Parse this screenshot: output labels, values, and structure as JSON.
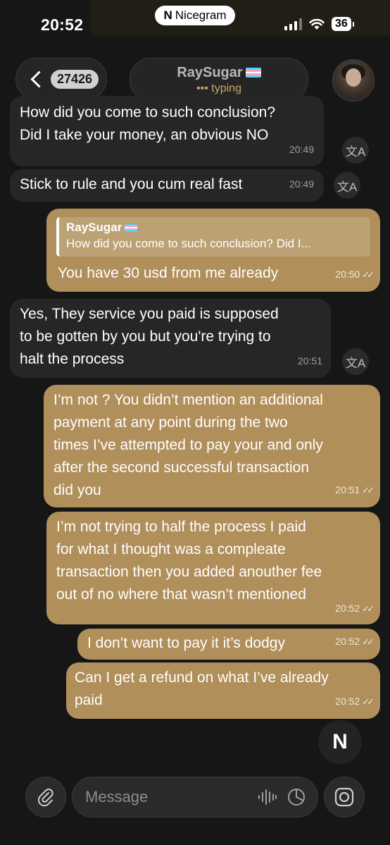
{
  "status": {
    "time": "20:52",
    "app_badge": "Nicegram",
    "battery": "36"
  },
  "header": {
    "back_count": "27426",
    "contact_name": "RaySugar",
    "status_text": "typing"
  },
  "messages": [
    {
      "dir": "in",
      "lines": [
        "How did you come to such conclusion?",
        "Did I take your money, an obvious NO"
      ],
      "time": "20:49",
      "translate": "文A"
    },
    {
      "dir": "in",
      "lines": [
        "Stick to rule and you cum real fast"
      ],
      "time": "20:49",
      "translate": "文A"
    },
    {
      "dir": "out",
      "reply_name": "RaySugar",
      "reply_text": "How did you come to such conclusion? Did I...",
      "lines": [
        "You have 30 usd from me already"
      ],
      "time": "20:50"
    },
    {
      "dir": "in",
      "lines": [
        "Yes, They service you paid is supposed",
        "to be gotten by you but you're trying to",
        "halt the process"
      ],
      "time": "20:51",
      "translate": "文A"
    },
    {
      "dir": "out",
      "lines": [
        "I’m not ? You didn’t mention an additional",
        "payment at any point during the two",
        "times I’ve attempted to pay your and only",
        "after the second successful transaction",
        "did you"
      ],
      "time": "20:51"
    },
    {
      "dir": "out",
      "lines": [
        "I’m not trying to half the process I paid",
        "for what I thought was a compleate",
        "transaction then you added anouther fee",
        "out of no where that wasn’t mentioned"
      ],
      "time": "20:52"
    },
    {
      "dir": "out",
      "lines": [
        "I don’t want to pay it it’s dodgy"
      ],
      "time": "20:52"
    },
    {
      "dir": "out",
      "lines": [
        "Can I get a refund on what I’ve already",
        "paid"
      ],
      "time": "20:52"
    }
  ],
  "composer": {
    "placeholder": "Message"
  },
  "icons": {
    "back": "chevron-left-icon",
    "attach": "paperclip-icon",
    "voice": "waveform-icon",
    "sticker": "sticker-icon",
    "camera": "camera-icon",
    "nicegram": "nicegram-logo-icon",
    "translate": "translate-icon"
  },
  "colors": {
    "outgoing_bubble": "#b08f5b",
    "incoming_bubble": "#262626",
    "accent": "#c9a865",
    "background": "#161616"
  }
}
